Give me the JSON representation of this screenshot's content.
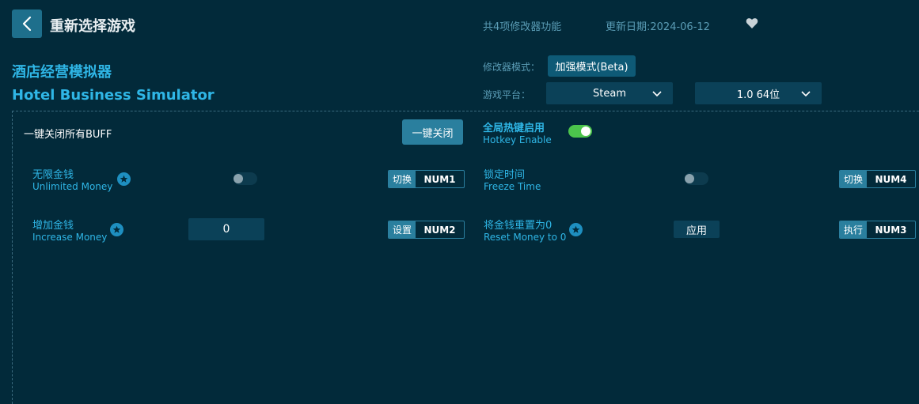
{
  "header": {
    "title": "重新选择游戏",
    "feature_count": "共4项修改器功能",
    "update_date": "更新日期:2024-06-12"
  },
  "game": {
    "name_cn": "酒店经营模拟器",
    "name_en": "Hotel Business Simulator"
  },
  "settings": {
    "mode_label": "修改器模式：",
    "mode_value": "加强模式(Beta)",
    "platform_label": "游戏平台：",
    "platform_value": "Steam",
    "version_value": "1.0 64位"
  },
  "panel": {
    "close_all_label": "一键关闭所有BUFF",
    "close_all_button": "一键关闭",
    "hotkey_cn": "全局热键启用",
    "hotkey_en": "Hotkey Enable",
    "hotkey_enabled": true
  },
  "features": [
    {
      "name_cn": "无限金钱",
      "name_en": "Unlimited Money",
      "action": "切换",
      "key": "NUM1",
      "state": false
    },
    {
      "name_cn": "锁定时间",
      "name_en": "Freeze Time",
      "action": "切换",
      "key": "NUM4",
      "state": false
    },
    {
      "name_cn": "增加金钱",
      "name_en": "Increase Money",
      "action": "设置",
      "key": "NUM2",
      "value": "0"
    },
    {
      "name_cn": "将金钱重置为0",
      "name_en": "Reset Money to 0",
      "action": "执行",
      "key": "NUM3",
      "apply_label": "应用"
    }
  ],
  "icons": {
    "back": "chevron-left-icon",
    "favorite": "heart-icon",
    "star": "star-icon",
    "dropdown": "chevron-down-icon"
  },
  "colors": {
    "background": "#022a3a",
    "accent": "#2fb6e6",
    "button": "#2a7f9e",
    "toggle_on": "#4cc44c"
  }
}
